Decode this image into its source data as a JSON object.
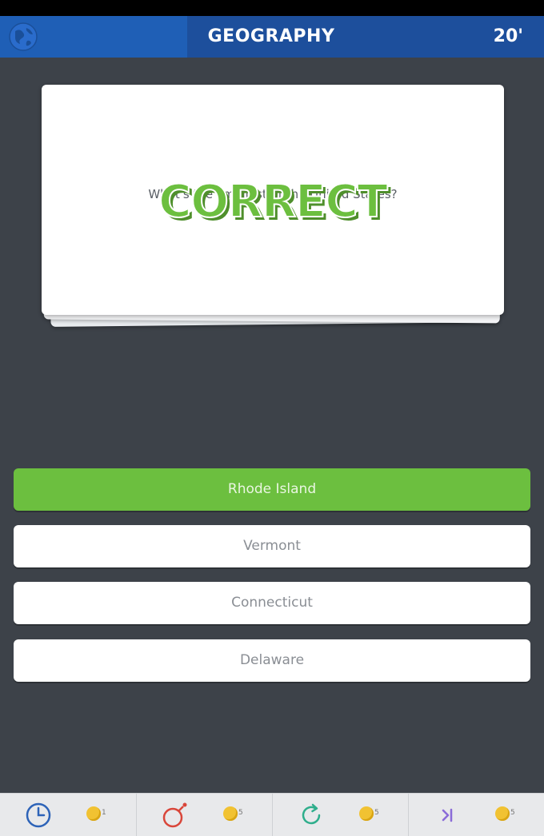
{
  "header": {
    "category": "GEOGRAPHY",
    "timer": "20'"
  },
  "question": {
    "text": "What's the smallest of the United States?",
    "result": "CORRECT"
  },
  "answers": [
    {
      "label": "Rhode Island",
      "state": "correct"
    },
    {
      "label": "Vermont",
      "state": "default"
    },
    {
      "label": "Connecticut",
      "state": "default"
    },
    {
      "label": "Delaware",
      "state": "default"
    }
  ],
  "powerups": [
    {
      "icon": "clock-icon",
      "cost": "1"
    },
    {
      "icon": "bomb-icon",
      "cost": "5"
    },
    {
      "icon": "refresh-icon",
      "cost": "5"
    },
    {
      "icon": "skip-icon",
      "cost": "5"
    }
  ],
  "colors": {
    "header_blue": "#1d4f9c",
    "category_blue": "#1f5fb6",
    "background": "#3d4249",
    "correct_green": "#6cbf3f"
  }
}
